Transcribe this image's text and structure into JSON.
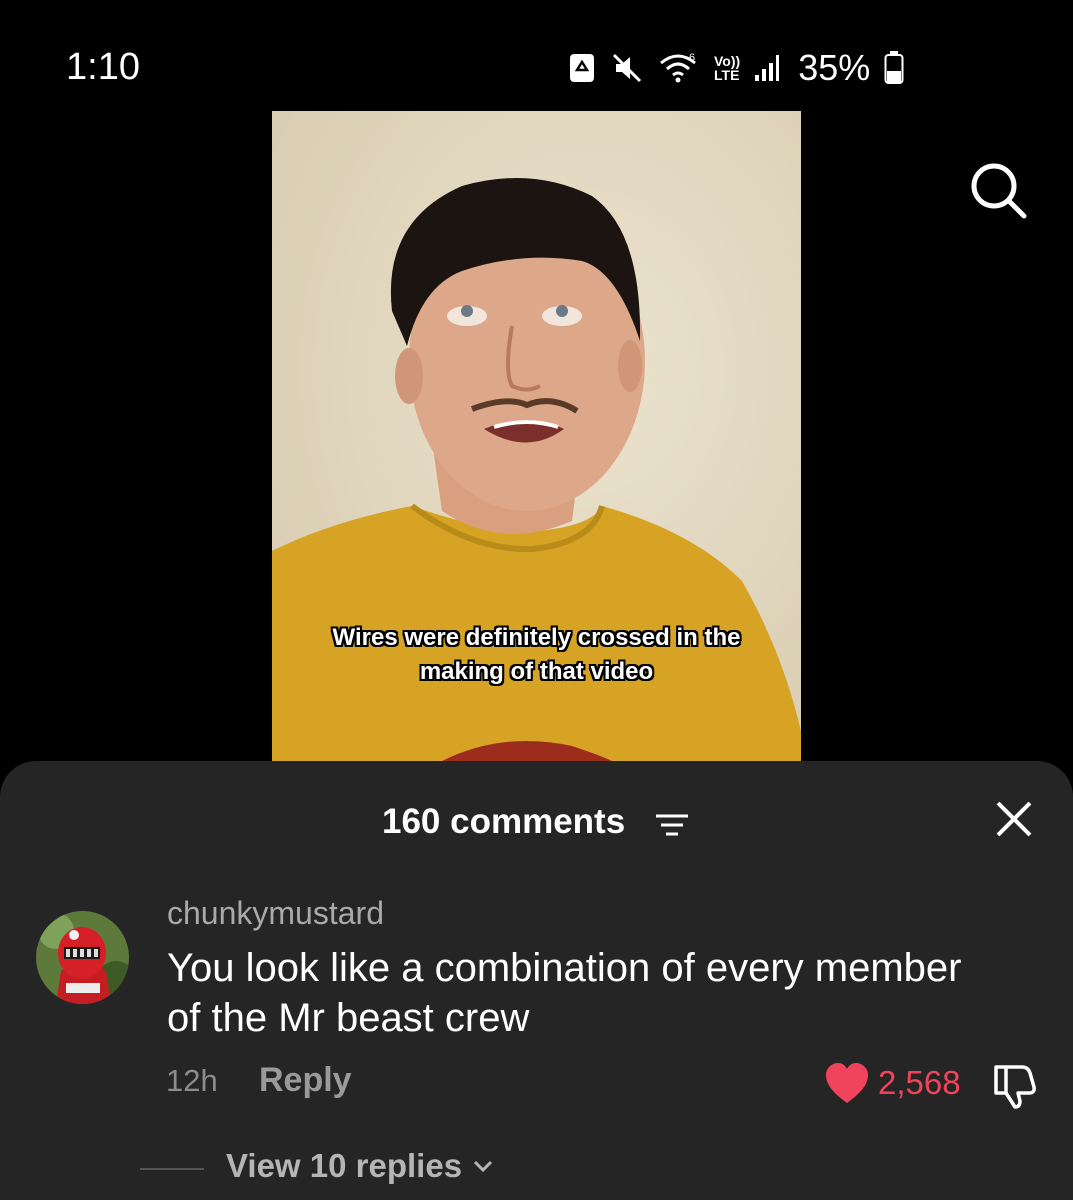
{
  "status_bar": {
    "time": "1:10",
    "battery": "35%",
    "network_top": "Vo))",
    "network_bottom": "LTE",
    "icons": [
      "recycle-icon",
      "mute-icon",
      "wifi-icon",
      "signal-icon",
      "battery-icon"
    ]
  },
  "video": {
    "caption": "Wires were definitely crossed in the making of that video"
  },
  "comments": {
    "count_label": "160 comments",
    "items": [
      {
        "username": "chunkymustard",
        "text": "You look like a combination of every member of the Mr beast crew",
        "time": "12h",
        "reply_label": "Reply",
        "likes": "2,568",
        "liked": true,
        "view_replies_label": "View 10 replies"
      }
    ]
  },
  "colors": {
    "sheet_bg": "#252525",
    "like_red": "#f0445c",
    "username_gray": "#a9a9a9"
  }
}
